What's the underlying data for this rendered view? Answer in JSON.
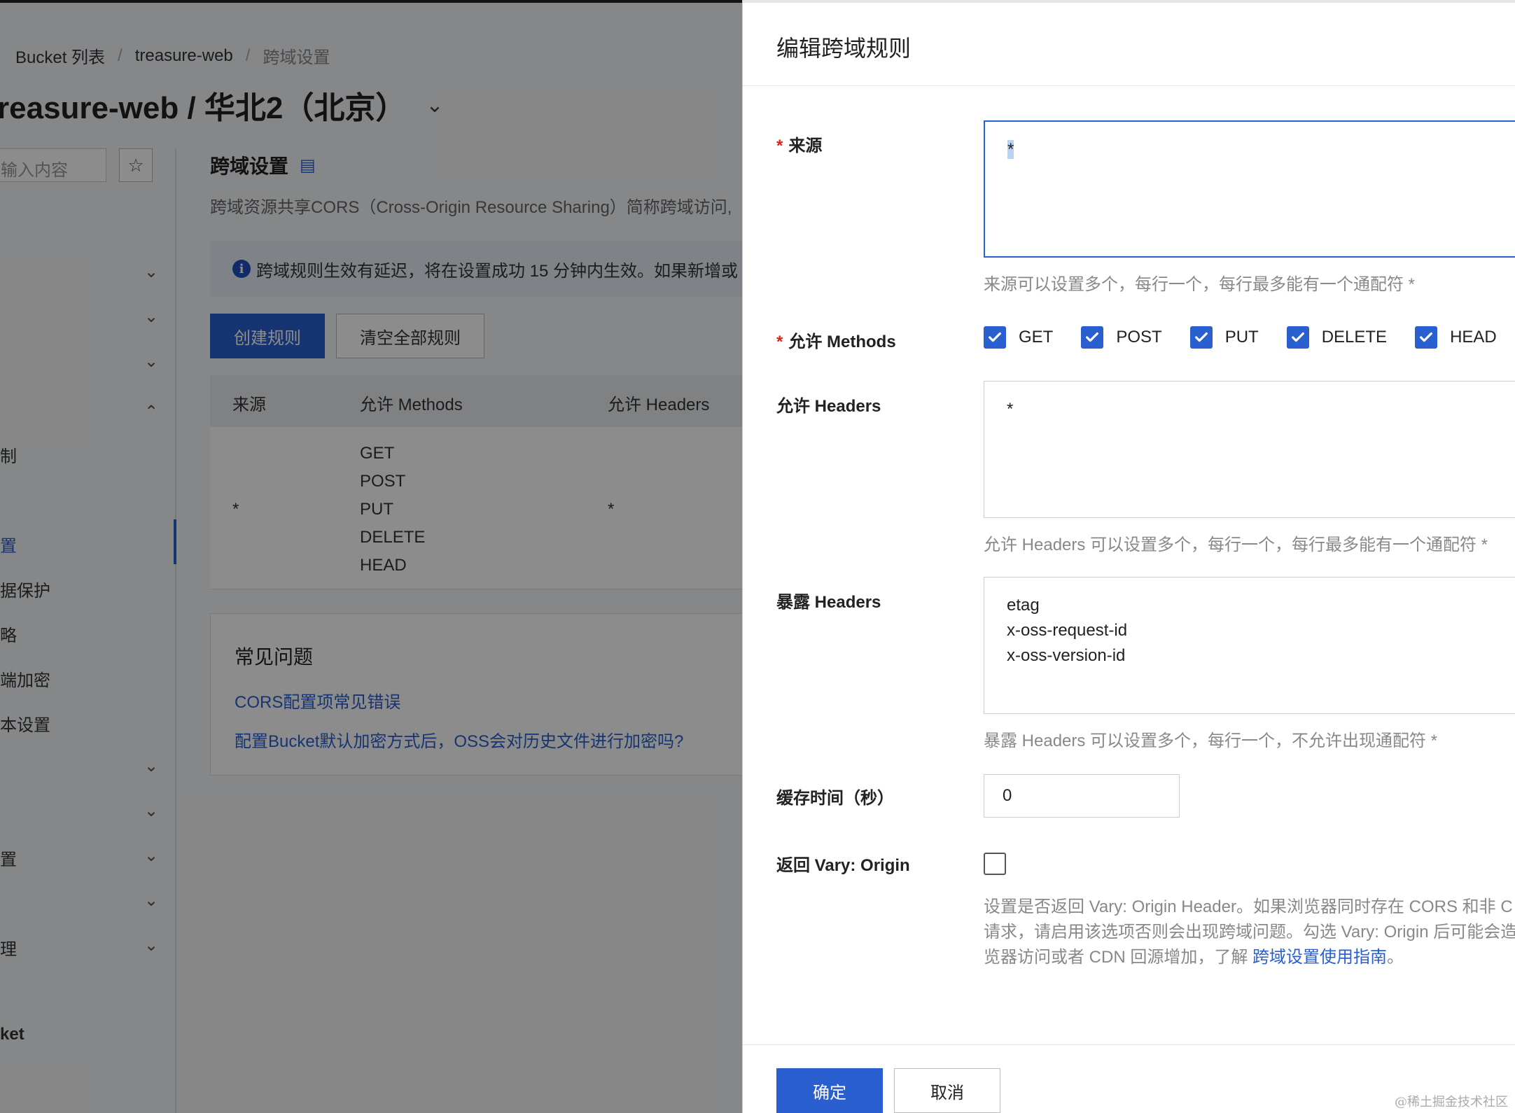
{
  "background": {
    "breadcrumb": [
      "Bucket 列表",
      "treasure-web",
      "跨域设置"
    ],
    "page_title": "reasure-web / 华北2（北京）",
    "sidebar": {
      "search_placeholder": "输入内容",
      "items": [
        {
          "label": "制"
        },
        {
          "label": "置",
          "active": true
        },
        {
          "label": "据保护"
        },
        {
          "label": "略"
        },
        {
          "label": "端加密"
        },
        {
          "label": "本设置"
        },
        {
          "label": "置"
        },
        {
          "label": "理"
        },
        {
          "label": "ket"
        }
      ]
    },
    "section_title": "跨域设置",
    "section_desc": "跨域资源共享CORS（Cross-Origin Resource Sharing）简称跨域访问,",
    "notice": "跨域规则生效有延迟，将在设置成功 15 分钟内生效。如果新增或",
    "buttons": {
      "create": "创建规则",
      "clear": "清空全部规则"
    },
    "table": {
      "headers": [
        "来源",
        "允许 Methods",
        "允许 Headers"
      ],
      "row": {
        "origin": "*",
        "methods": [
          "GET",
          "POST",
          "PUT",
          "DELETE",
          "HEAD"
        ],
        "headers": "*"
      }
    },
    "faq": {
      "title": "常见问题",
      "links": [
        "CORS配置项常见错误",
        "配置Bucket默认加密方式后，OSS会对历史文件进行加密吗?"
      ]
    }
  },
  "drawer": {
    "title": "编辑跨域规则",
    "origin": {
      "label": "来源",
      "value": "*",
      "help": "来源可以设置多个，每行一个，每行最多能有一个通配符 *"
    },
    "methods": {
      "label": "允许 Methods",
      "options": [
        {
          "label": "GET",
          "checked": true
        },
        {
          "label": "POST",
          "checked": true
        },
        {
          "label": "PUT",
          "checked": true
        },
        {
          "label": "DELETE",
          "checked": true
        },
        {
          "label": "HEAD",
          "checked": true
        }
      ]
    },
    "allow_headers": {
      "label": "允许 Headers",
      "value": "*",
      "help": "允许 Headers 可以设置多个，每行一个，每行最多能有一个通配符 *"
    },
    "expose_headers": {
      "label": "暴露 Headers",
      "value": "etag\nx-oss-request-id\nx-oss-version-id",
      "help": "暴露 Headers 可以设置多个，每行一个，不允许出现通配符 *"
    },
    "cache": {
      "label": "缓存时间（秒）",
      "value": "0"
    },
    "vary": {
      "label": "返回 Vary: Origin",
      "checked": false,
      "desc_line1": "设置是否返回 Vary: Origin Header。如果浏览器同时存在 CORS 和非 C",
      "desc_line2": "请求，请启用该选项否则会出现跨域问题。勾选 Vary: Origin 后可能会造",
      "desc_line3_pre": "览器访问或者 CDN 回源增加，了解 ",
      "desc_link": "跨域设置使用指南",
      "desc_line3_post": "。"
    },
    "footer": {
      "ok": "确定",
      "cancel": "取消"
    },
    "watermark": "@稀土掘金技术社区"
  }
}
